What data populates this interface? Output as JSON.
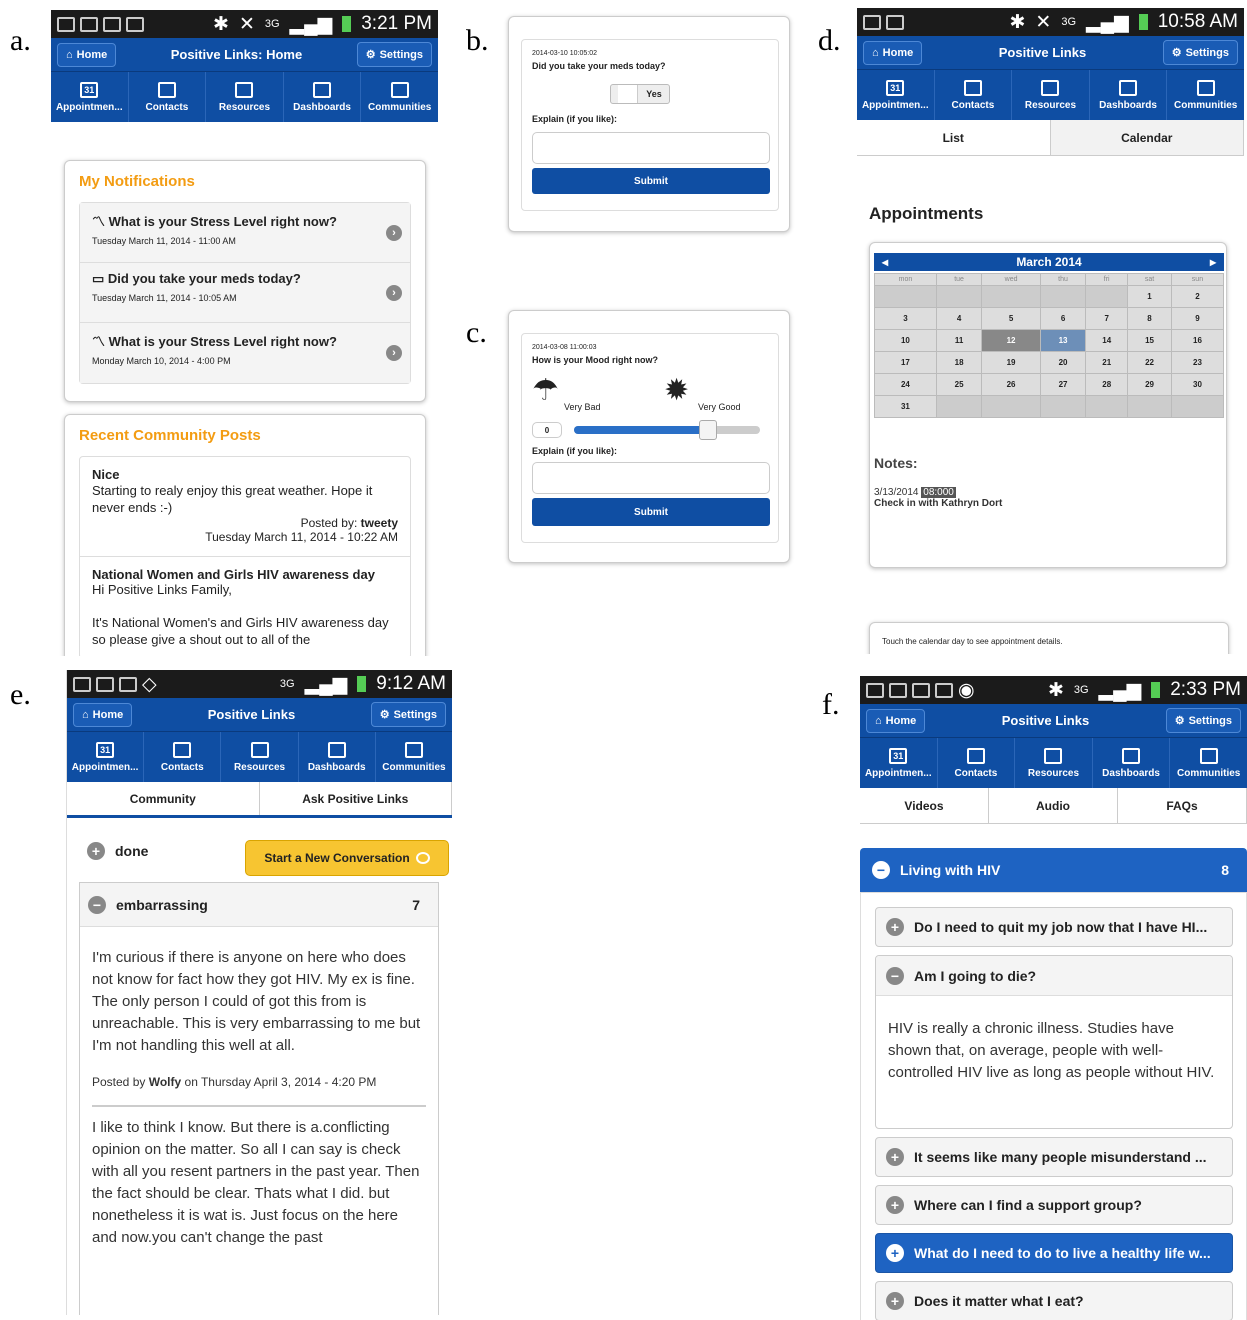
{
  "labels": {
    "a": "a.",
    "b": "b.",
    "c": "c.",
    "d": "d.",
    "e": "e.",
    "f": "f."
  },
  "common": {
    "home": "Home",
    "settings": "Settings",
    "nav": [
      "Appointmen...",
      "Contacts",
      "Resources",
      "Dashboards",
      "Communities"
    ],
    "cal_icon": "31",
    "threeg": "3G"
  },
  "a": {
    "time": "3:21 PM",
    "title": "Positive Links: Home",
    "notif_head": "My Notifications",
    "notifs": [
      {
        "icon": "trend-icon",
        "title": "What is your Stress Level right now?",
        "date": "Tuesday March 11, 2014 - 11:00 AM"
      },
      {
        "icon": "toggle-icon",
        "title": "Did you take your meds today?",
        "date": "Tuesday March 11, 2014 - 10:05 AM"
      },
      {
        "icon": "trend-icon",
        "title": "What is your Stress Level right now?",
        "date": "Monday March 10, 2014 - 4:00 PM"
      }
    ],
    "posts_head": "Recent Community Posts",
    "post1": {
      "title": "Nice",
      "body": "Starting to realy enjoy this great weather. Hope it never ends :-)",
      "by_label": "Posted by:",
      "by": "tweety",
      "date": "Tuesday March 11, 2014 - 10:22 AM"
    },
    "post2": {
      "title": "National Women and Girls HIV awareness day",
      "line1": "Hi Positive Links Family,",
      "line2": "It's National Women's and Girls HIV awareness day so please give a shout out to all of the"
    }
  },
  "b": {
    "stamp": "2014-03-10 10:05:02",
    "question": "Did you take your meds today?",
    "toggle": "Yes",
    "explain": "Explain (if you like):",
    "submit": "Submit"
  },
  "c": {
    "stamp": "2014-03-08 11:00:03",
    "question": "How is your Mood right now?",
    "bad": "Very Bad",
    "good": "Very Good",
    "value": "0",
    "slider_level": 0.72,
    "explain": "Explain (if you like):",
    "submit": "Submit"
  },
  "d": {
    "time": "10:58 AM",
    "title": "Positive Links",
    "tabs": [
      "List",
      "Calendar"
    ],
    "heading": "Appointments",
    "month": "March 2014",
    "weekdays": [
      "mon",
      "tue",
      "wed",
      "thu",
      "fri",
      "sat",
      "sun"
    ],
    "weeks": [
      [
        "",
        "",
        "",
        "",
        "",
        "1",
        "2"
      ],
      [
        "3",
        "4",
        "5",
        "6",
        "7",
        "8",
        "9"
      ],
      [
        "10",
        "11",
        "12",
        "13",
        "14",
        "15",
        "16"
      ],
      [
        "17",
        "18",
        "19",
        "20",
        "21",
        "22",
        "23"
      ],
      [
        "24",
        "25",
        "26",
        "27",
        "28",
        "29",
        "30"
      ],
      [
        "31",
        "",
        "",
        "",
        "",
        "",
        ""
      ]
    ],
    "notes_label": "Notes:",
    "note_date": "3/13/2014",
    "note_time": "08:000",
    "note_text": "Check in with Kathryn Dort",
    "hint": "Touch the calendar day to see appointment details."
  },
  "e": {
    "time": "9:12 AM",
    "title": "Positive Links",
    "tabs": [
      "Community",
      "Ask Positive Links"
    ],
    "done": "done",
    "start": "Start a New Conversation",
    "topic": "embarrassing",
    "count": "7",
    "post1": "I'm curious if there is anyone on here who does not know for fact how they got HIV. My ex is fine. The only person I could of got this from is unreachable. This is very embarrassing to me but I'm not handling this well at all.",
    "meta_pre": "Posted by",
    "meta_user": "Wolfy",
    "meta_post": "on Thursday April 3, 2014 - 4:20 PM",
    "post2": "I like to think I know. But there is a.conflicting opinion on the matter. So all I can say is check with all you resent partners in the past year. Then the fact should be clear. Thats what I did. but nonetheless it is wat is. Just focus on the here and now.you can't change the past"
  },
  "f": {
    "time": "2:33 PM",
    "title": "Positive Links",
    "tabs": [
      "Videos",
      "Audio",
      "FAQs"
    ],
    "section": "Living with HIV",
    "section_count": "8",
    "q1": "Do I need to quit my job now that I have HI...",
    "q2": "Am I going to die?",
    "a2": "HIV is really a chronic illness. Studies have shown that, on average, people with well-controlled HIV live as long as people without HIV.",
    "q3": "It seems like many people misunderstand ...",
    "q4": "Where can I find a support group?",
    "q5": "What do I need to do to live a healthy life w...",
    "q6": "Does it matter what I eat?"
  }
}
